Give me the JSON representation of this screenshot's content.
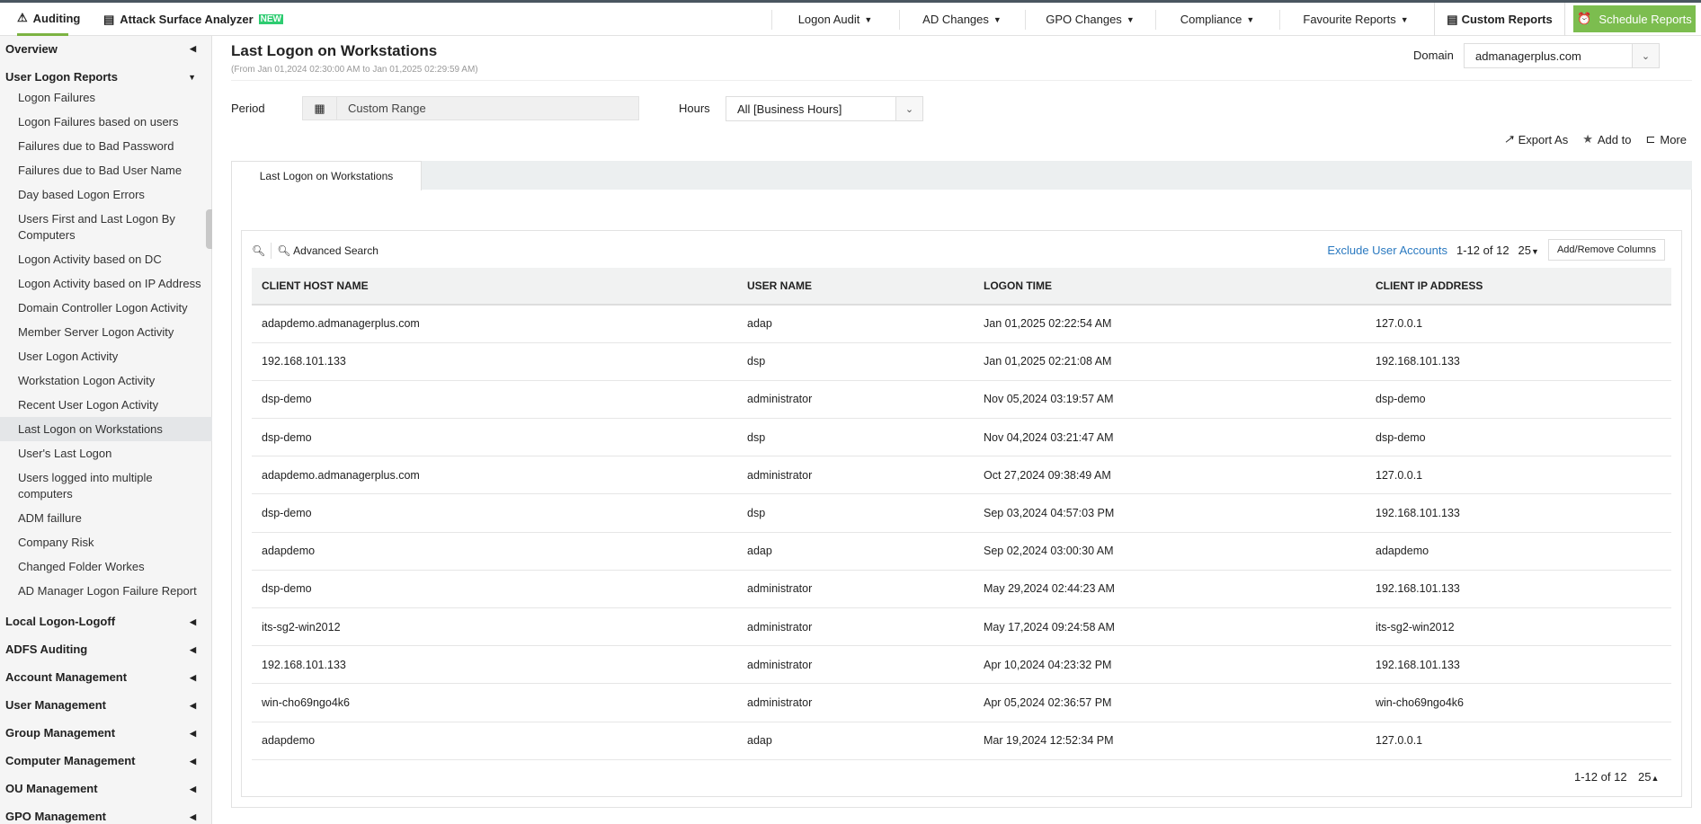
{
  "top": {
    "tabs": [
      {
        "label": "Auditing"
      },
      {
        "label": "Attack Surface Analyzer",
        "badge": "NEW"
      }
    ],
    "nav": [
      "Logon Audit",
      "AD Changes",
      "GPO Changes",
      "Compliance",
      "Favourite Reports"
    ],
    "custom_reports": "Custom Reports",
    "schedule_reports": "Schedule Reports"
  },
  "sidebar": {
    "sections_top": [
      {
        "label": "Overview"
      },
      {
        "label": "User Logon Reports"
      }
    ],
    "items": [
      "Logon Failures",
      "Logon Failures based on users",
      "Failures due to Bad Password",
      "Failures due to Bad User Name",
      "Day based Logon Errors",
      "Users First and Last Logon By Computers",
      "Logon Activity based on DC",
      "Logon Activity based on IP Address",
      "Domain Controller Logon Activity",
      "Member Server Logon Activity",
      "User Logon Activity",
      "Workstation Logon Activity",
      "Recent User Logon Activity",
      "Last Logon on Workstations",
      "User's Last Logon",
      "Users logged into multiple computers",
      "ADM faillure",
      "Company Risk",
      "Changed Folder Workes",
      "AD Manager Logon Failure Report"
    ],
    "selected": "Last Logon on Workstations",
    "sections": [
      "Local Logon-Logoff",
      "ADFS Auditing",
      "Account Management",
      "User Management",
      "Group Management",
      "Computer Management",
      "OU Management",
      "GPO Management"
    ]
  },
  "main": {
    "title": "Last Logon on Workstations",
    "subtitle": "(From Jan 01,2024 02:30:00 AM to Jan 01,2025 02:29:59 AM)",
    "domain_label": "Domain",
    "domain_value": "admanagerplus.com",
    "period_label": "Period",
    "period_value": "Custom Range",
    "hours_label": "Hours",
    "hours_value": "All [Business Hours]",
    "export": "Export As",
    "add_to": "Add to",
    "more": "More",
    "report_tab": "Last Logon on Workstations",
    "advanced_search": "Advanced Search",
    "exclude": "Exclude User Accounts",
    "range": "1-12 of 12",
    "page_size": "25",
    "add_remove": "Add/Remove Columns",
    "columns": [
      "CLIENT HOST NAME",
      "USER NAME",
      "LOGON TIME",
      "CLIENT IP ADDRESS"
    ],
    "rows": [
      [
        "adapdemo.admanagerplus.com",
        "adap",
        "Jan 01,2025 02:22:54 AM",
        "127.0.0.1"
      ],
      [
        "192.168.101.133",
        "dsp",
        "Jan 01,2025 02:21:08 AM",
        "192.168.101.133"
      ],
      [
        "dsp-demo",
        "administrator",
        "Nov 05,2024 03:19:57 AM",
        "dsp-demo"
      ],
      [
        "dsp-demo",
        "dsp",
        "Nov 04,2024 03:21:47 AM",
        "dsp-demo"
      ],
      [
        "adapdemo.admanagerplus.com",
        "administrator",
        "Oct 27,2024 09:38:49 AM",
        "127.0.0.1"
      ],
      [
        "dsp-demo",
        "dsp",
        "Sep 03,2024 04:57:03 PM",
        "192.168.101.133"
      ],
      [
        "adapdemo",
        "adap",
        "Sep 02,2024 03:00:30 AM",
        "adapdemo"
      ],
      [
        "dsp-demo",
        "administrator",
        "May 29,2024 02:44:23 AM",
        "192.168.101.133"
      ],
      [
        "its-sg2-win2012",
        "administrator",
        "May 17,2024 09:24:58 AM",
        "its-sg2-win2012"
      ],
      [
        "192.168.101.133",
        "administrator",
        "Apr 10,2024 04:23:32 PM",
        "192.168.101.133"
      ],
      [
        "win-cho69ngo4k6",
        "administrator",
        "Apr 05,2024 02:36:57 PM",
        "win-cho69ngo4k6"
      ],
      [
        "adapdemo",
        "adap",
        "Mar 19,2024 12:52:34 PM",
        "127.0.0.1"
      ]
    ],
    "footer_range": "1-12 of 12",
    "footer_size": "25"
  }
}
